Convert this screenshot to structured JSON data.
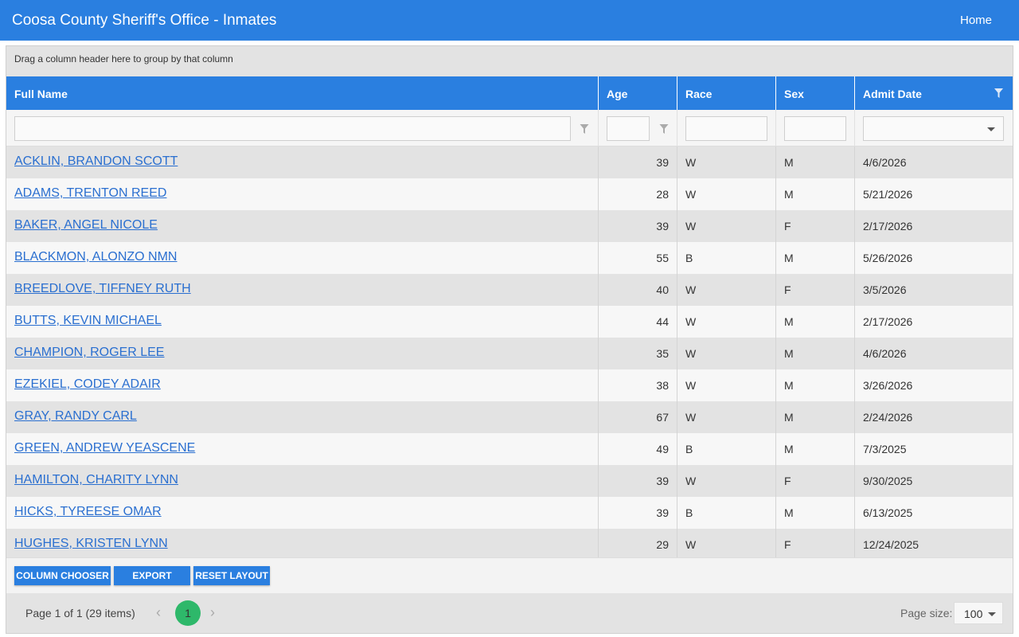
{
  "header": {
    "title": "Coosa County Sheriff's Office - Inmates",
    "home_label": "Home"
  },
  "grid": {
    "group_panel_text": "Drag a column header here to group by that column",
    "columns": {
      "full_name": "Full Name",
      "age": "Age",
      "race": "Race",
      "sex": "Sex",
      "admit_date": "Admit Date"
    },
    "rows": [
      {
        "name": "ACKLIN, BRANDON SCOTT",
        "age": "39",
        "race": "W",
        "sex": "M",
        "admit": "4/6/2026"
      },
      {
        "name": "ADAMS, TRENTON REED",
        "age": "28",
        "race": "W",
        "sex": "M",
        "admit": "5/21/2026"
      },
      {
        "name": "BAKER, ANGEL NICOLE",
        "age": "39",
        "race": "W",
        "sex": "F",
        "admit": "2/17/2026"
      },
      {
        "name": "BLACKMON, ALONZO NMN",
        "age": "55",
        "race": "B",
        "sex": "M",
        "admit": "5/26/2026"
      },
      {
        "name": "BREEDLOVE, TIFFNEY RUTH",
        "age": "40",
        "race": "W",
        "sex": "F",
        "admit": "3/5/2026"
      },
      {
        "name": "BUTTS, KEVIN MICHAEL",
        "age": "44",
        "race": "W",
        "sex": "M",
        "admit": "2/17/2026"
      },
      {
        "name": "CHAMPION, ROGER LEE",
        "age": "35",
        "race": "W",
        "sex": "M",
        "admit": "4/6/2026"
      },
      {
        "name": "EZEKIEL, CODEY ADAIR",
        "age": "38",
        "race": "W",
        "sex": "M",
        "admit": "3/26/2026"
      },
      {
        "name": "GRAY, RANDY CARL",
        "age": "67",
        "race": "W",
        "sex": "M",
        "admit": "2/24/2026"
      },
      {
        "name": "GREEN, ANDREW YEASCENE",
        "age": "49",
        "race": "B",
        "sex": "M",
        "admit": "7/3/2025"
      },
      {
        "name": "HAMILTON, CHARITY LYNN",
        "age": "39",
        "race": "W",
        "sex": "F",
        "admit": "9/30/2025"
      },
      {
        "name": "HICKS, TYREESE OMAR",
        "age": "39",
        "race": "B",
        "sex": "M",
        "admit": "6/13/2025"
      },
      {
        "name": "HUGHES, KRISTEN LYNN",
        "age": "29",
        "race": "W",
        "sex": "F",
        "admit": "12/24/2025"
      }
    ],
    "toolbar": {
      "column_chooser": "COLUMN CHOOSER",
      "export": "EXPORT",
      "reset_layout": "RESET LAYOUT"
    },
    "pager": {
      "info": "Page 1 of 1 (29 items)",
      "current_page": "1",
      "page_size_label": "Page size:",
      "page_size": "100"
    }
  },
  "colors": {
    "accent": "#2a7fe0",
    "link": "#2a6fd0",
    "active_page": "#2eb86a"
  }
}
